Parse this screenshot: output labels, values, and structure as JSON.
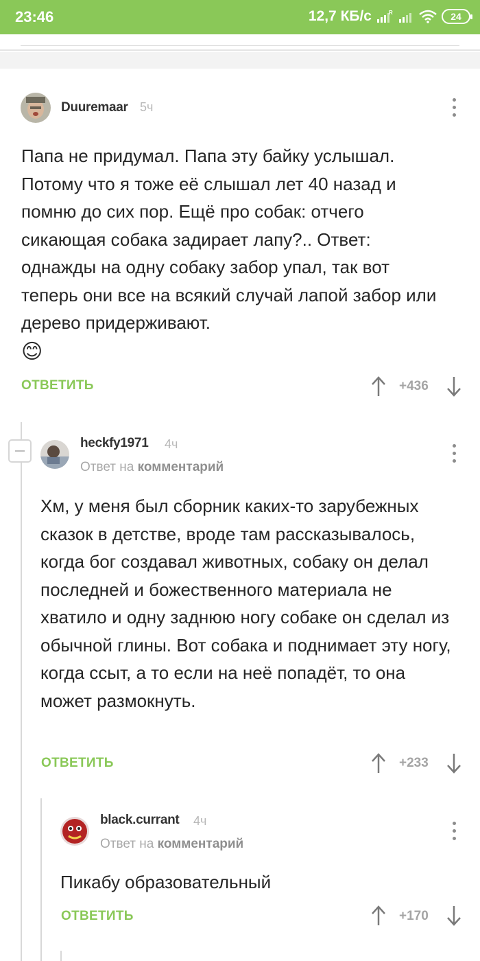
{
  "status_bar": {
    "time": "23:46",
    "network_speed": "12,7 КБ/с",
    "battery": "24"
  },
  "comments": [
    {
      "author": "Duuremaar",
      "time": "5ч",
      "text": "Папа не придумал. Папа эту байку услышал. Потому что я тоже её слышал лет 40 назад и помню до сих пор. Ещё про собак: отчего сикающая собака задирает лапу?.. Ответ: однажды на одну собаку забор упал, так вот теперь они все на всякий случай лапой забор или дерево придерживают.",
      "emoji": "😊",
      "reply_label": "ОТВЕТИТЬ",
      "rating": "+436"
    },
    {
      "author": "heckfy1971",
      "time": "4ч",
      "reply_to_prefix": "Ответ на",
      "reply_to_link": "комментарий",
      "text": "Хм, у меня был сборник каких-то зарубежных сказок в детстве, вроде там рассказывалось, когда бог создавал животных, собаку он делал последней и божественного материала не хватило и одну заднюю ногу собаке он сделал из обычной глины. Вот собака и поднимает эту ногу, когда ссыт, а то если на неё попадёт, то она может размокнуть.",
      "reply_label": "ОТВЕТИТЬ",
      "rating": "+233"
    },
    {
      "author": "black.currant",
      "time": "4ч",
      "reply_to_prefix": "Ответ на",
      "reply_to_link": "комментарий",
      "text": "Пикабу образовательный",
      "reply_label": "ОТВЕТИТЬ",
      "rating": "+170"
    }
  ],
  "colors": {
    "accent": "#8ac858",
    "status_bar": "#8ac858",
    "muted": "#a8a8a8"
  }
}
